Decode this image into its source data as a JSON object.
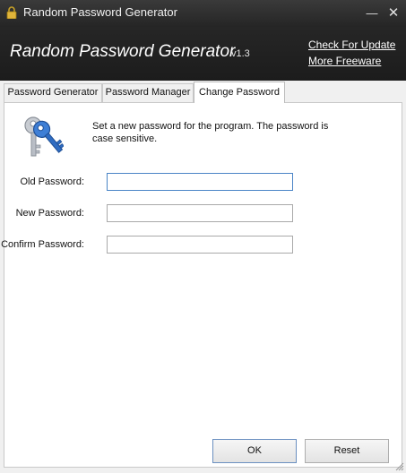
{
  "window": {
    "title": "Random Password Generator"
  },
  "banner": {
    "app_name": "Random Password Generator",
    "version": "v1.3",
    "link_update": "Check For Update",
    "link_more": "More Freeware"
  },
  "tabs": [
    {
      "label": "Password Generator",
      "active": false
    },
    {
      "label": "Password Manager",
      "active": false
    },
    {
      "label": "Change Password",
      "active": true
    }
  ],
  "change_password": {
    "description": "Set a new password for the program. The password is case sensitive.",
    "old_label": "Old Password:",
    "new_label": "New Password:",
    "confirm_label": "Confirm Password:",
    "old_value": "",
    "new_value": "",
    "confirm_value": ""
  },
  "buttons": {
    "ok": "OK",
    "reset": "Reset"
  },
  "icons": {
    "title": "lock-icon",
    "panel": "keys-icon"
  },
  "colors": {
    "banner_bg": "#1c1c1c",
    "focus_border": "#4a84c6"
  }
}
